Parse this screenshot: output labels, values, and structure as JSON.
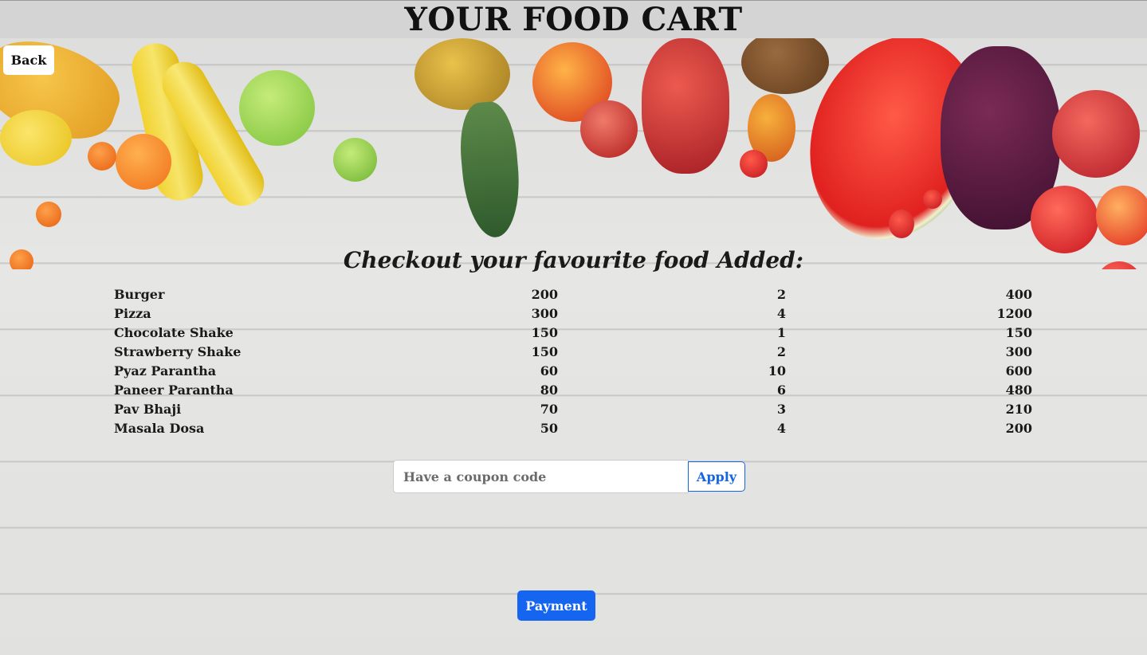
{
  "header": {
    "title": "YOUR FOOD CART"
  },
  "nav": {
    "back_label": "Back"
  },
  "cart": {
    "heading": "Checkout your favourite food Added:",
    "items": [
      {
        "name": "Burger",
        "price": "200",
        "qty": "2",
        "total": "400"
      },
      {
        "name": "Pizza",
        "price": "300",
        "qty": "4",
        "total": "1200"
      },
      {
        "name": "Chocolate Shake",
        "price": "150",
        "qty": "1",
        "total": "150"
      },
      {
        "name": "Strawberry Shake",
        "price": "150",
        "qty": "2",
        "total": "300"
      },
      {
        "name": "Pyaz Parantha",
        "price": "60",
        "qty": "10",
        "total": "600"
      },
      {
        "name": "Paneer Parantha",
        "price": "80",
        "qty": "6",
        "total": "480"
      },
      {
        "name": "Pav Bhaji",
        "price": "70",
        "qty": "3",
        "total": "210"
      },
      {
        "name": "Masala Dosa",
        "price": "50",
        "qty": "4",
        "total": "200"
      }
    ]
  },
  "coupon": {
    "placeholder": "Have a coupon code",
    "value": "",
    "apply_label": "Apply"
  },
  "payment": {
    "label": "Payment"
  },
  "colors": {
    "primary": "#1565f0",
    "header_bg": "#d4d4d4",
    "background": "#e1e1df"
  },
  "background_image": "fruits-on-wooden-table"
}
